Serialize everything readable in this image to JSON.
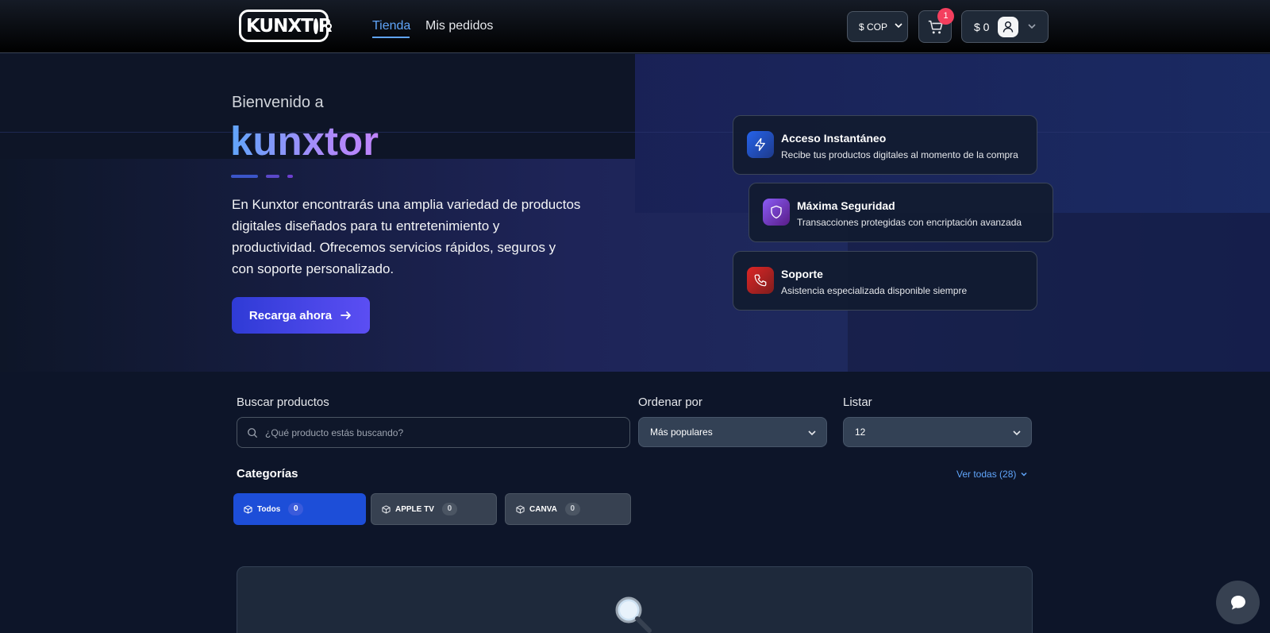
{
  "header": {
    "logo_text": "KUNXT",
    "logo_text_end": "R",
    "nav": [
      {
        "label": "Tienda",
        "active": true
      },
      {
        "label": "Mis pedidos",
        "active": false
      }
    ],
    "currency": "$ COP",
    "cart_count": "1",
    "balance": "$ 0",
    "icons": [
      "cart-icon",
      "user-icon",
      "chevron-down-icon"
    ]
  },
  "hero": {
    "welcome": "Bienvenido a",
    "brand": "kunxtor",
    "description": "En Kunxtor encontrarás una amplia variedad de productos digitales diseñados para tu entretenimiento y productividad. Ofrecemos servicios rápidos, seguros y con soporte personalizado.",
    "cta_label": "Recarga ahora",
    "features": [
      {
        "title": "Acceso Instantáneo",
        "subtitle": "Recibe tus productos digitales al momento de la compra",
        "icon": "lightning-icon",
        "color": "#1d4ed8"
      },
      {
        "title": "Máxima Seguridad",
        "subtitle": "Transacciones protegidas con encriptación avanzada",
        "icon": "shield-icon",
        "color": "#7c3aed"
      },
      {
        "title": "Soporte",
        "subtitle": "Asistencia especializada disponible siempre",
        "icon": "phone-icon",
        "color": "#b91c1c"
      }
    ]
  },
  "filters": {
    "search_label": "Buscar productos",
    "search_placeholder": "¿Qué producto estás buscando?",
    "sort_label": "Ordenar por",
    "sort_value": "Más populares",
    "list_label": "Listar",
    "list_value": "12"
  },
  "categories": {
    "title": "Categorías",
    "see_all": "Ver todas (28)",
    "items": [
      {
        "label": "Todos",
        "count": "0",
        "active": true
      },
      {
        "label": "APPLE TV",
        "count": "0",
        "active": false
      },
      {
        "label": "CANVA",
        "count": "0",
        "active": false
      }
    ]
  },
  "colors": {
    "accent": "#60a5fa",
    "primary_button": "#4338ca",
    "active_chip": "#1d4ed8",
    "badge": "#f43f5e"
  }
}
